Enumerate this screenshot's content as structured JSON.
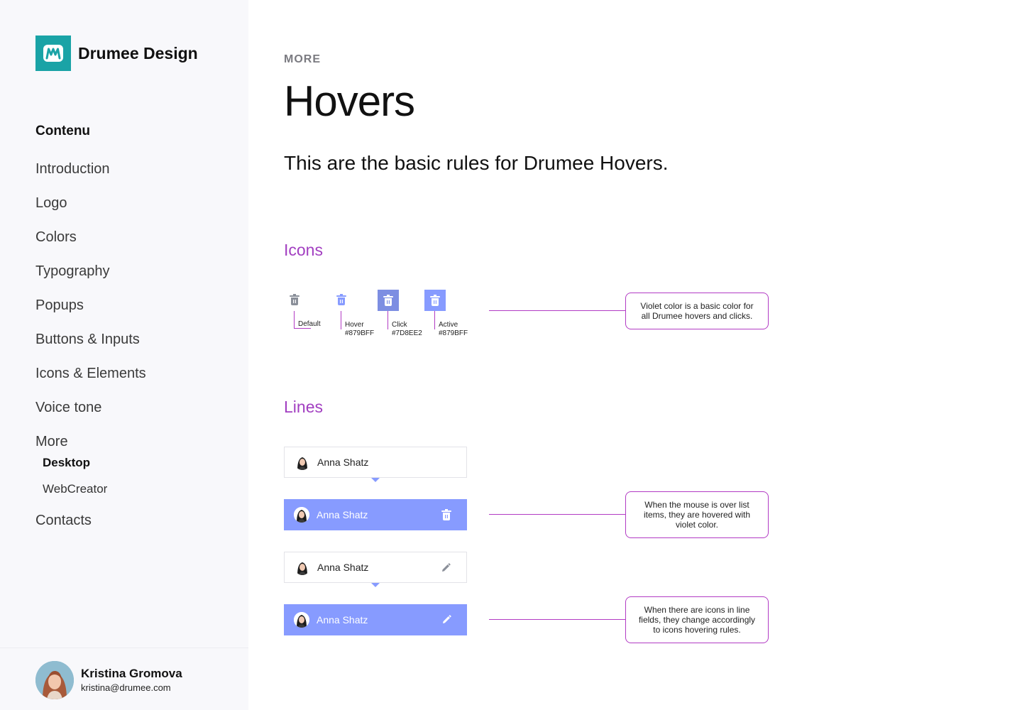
{
  "brand": {
    "name": "Drumee Design",
    "logo_letter": "M",
    "color": "#1aa3a6"
  },
  "sidebar": {
    "heading": "Contenu",
    "items": [
      {
        "label": "Introduction"
      },
      {
        "label": "Logo"
      },
      {
        "label": "Colors"
      },
      {
        "label": "Typography"
      },
      {
        "label": "Popups"
      },
      {
        "label": "Buttons & Inputs"
      },
      {
        "label": "Icons & Elements"
      },
      {
        "label": "Voice tone"
      },
      {
        "label": "More"
      }
    ],
    "subitems": [
      {
        "label": "Desktop",
        "active": true
      },
      {
        "label": "WebCreator",
        "active": false
      }
    ],
    "last_item": {
      "label": "Contacts"
    }
  },
  "user": {
    "name": "Kristina Gromova",
    "email": "kristina@drumee.com"
  },
  "main": {
    "eyebrow": "MORE",
    "title": "Hovers",
    "lead": "This are the basic rules for Drumee Hovers.",
    "icons_section": {
      "title": "Icons",
      "states": [
        {
          "label": "Default",
          "code": ""
        },
        {
          "label": "Hover",
          "code": "#879BFF"
        },
        {
          "label": "Click",
          "code": "#7D8EE2"
        },
        {
          "label": "Active",
          "code": "#879BFF"
        }
      ],
      "note": "Violet color is a basic color for all Drumee hovers and clicks."
    },
    "lines_section": {
      "title": "Lines",
      "rows": [
        {
          "name": "Anna Shatz",
          "state": "default",
          "action_icon": ""
        },
        {
          "name": "Anna Shatz",
          "state": "hover",
          "action_icon": "trash-icon"
        },
        {
          "name": "Anna Shatz",
          "state": "default",
          "action_icon": "pencil-icon"
        },
        {
          "name": "Anna Shatz",
          "state": "hover",
          "action_icon": "pencil-icon"
        }
      ],
      "notes": [
        "When the mouse is over list items, they are hovered with violet color.",
        "When  there are icons in line fields, they change accordingly to icons hovering rules."
      ]
    }
  },
  "colors": {
    "accent": "#a23fc1",
    "hover": "#879BFF",
    "click": "#7D8EE2",
    "default_icon": "#8a8f99"
  }
}
